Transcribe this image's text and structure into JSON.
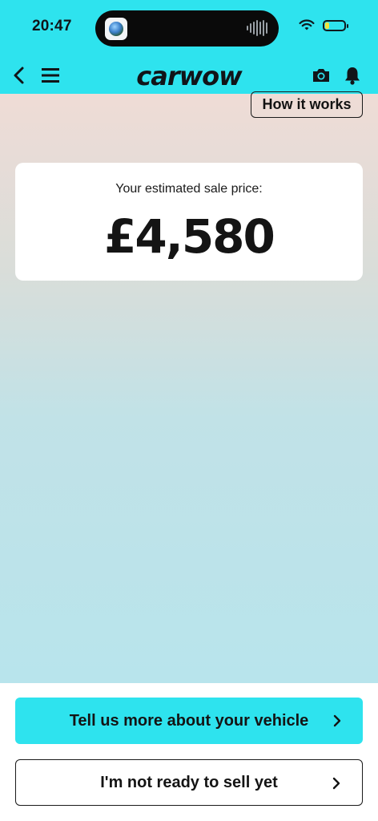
{
  "status_bar": {
    "time": "20:47",
    "battery_level": 0.2,
    "battery_color": "#f4e43a"
  },
  "header": {
    "brand": "carwow",
    "accent_color": "#2ee3ee",
    "icons": [
      "back-icon",
      "menu-icon",
      "camera-icon",
      "bell-icon"
    ]
  },
  "main": {
    "how_it_works_label": "How it works",
    "price_label": "Your estimated sale price:",
    "price_value": "£4,580"
  },
  "footer": {
    "primary_button_label": "Tell us more about your vehicle",
    "secondary_button_label": "I'm not ready to sell yet"
  }
}
